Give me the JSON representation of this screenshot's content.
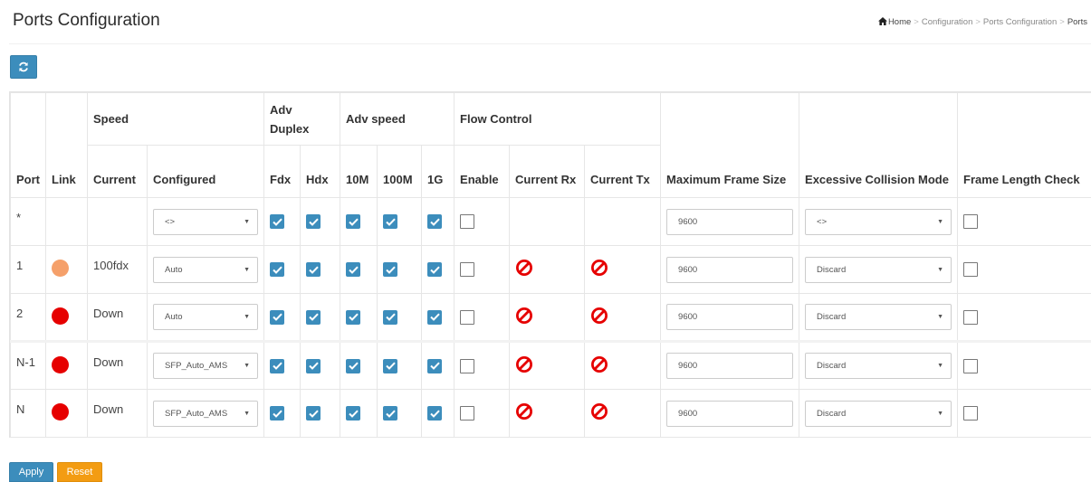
{
  "header": {
    "title": "Ports Configuration",
    "breadcrumb": [
      "Home",
      "Configuration",
      "Ports Configuration",
      "Ports"
    ]
  },
  "columns": {
    "port": "Port",
    "link": "Link",
    "speed": "Speed",
    "current": "Current",
    "configured": "Configured",
    "adv_duplex": "Adv Duplex",
    "fdx": "Fdx",
    "hdx": "Hdx",
    "adv_speed": "Adv speed",
    "s10m": "10M",
    "s100m": "100M",
    "s1g": "1G",
    "flow_control": "Flow Control",
    "enable": "Enable",
    "current_rx": "Current Rx",
    "current_tx": "Current Tx",
    "max_frame": "Maximum Frame Size",
    "excessive_collision": "Excessive Collision Mode",
    "frame_length_check": "Frame Length Check"
  },
  "rows": [
    {
      "port": "*",
      "link": "",
      "current": "",
      "configured": "<>",
      "max_frame": "9600",
      "collision": "<>"
    },
    {
      "port": "1",
      "link": "orange",
      "current": "100fdx",
      "configured": "Auto",
      "max_frame": "9600",
      "collision": "Discard"
    },
    {
      "port": "2",
      "link": "red",
      "current": "Down",
      "configured": "Auto",
      "max_frame": "9600",
      "collision": "Discard"
    },
    {
      "port": "N-1",
      "link": "red",
      "current": "Down",
      "configured": "SFP_Auto_AMS",
      "max_frame": "9600",
      "collision": "Discard"
    },
    {
      "port": "N",
      "link": "red",
      "current": "Down",
      "configured": "SFP_Auto_AMS",
      "max_frame": "9600",
      "collision": "Discard"
    }
  ],
  "colors": {
    "primary": "#3c8dbc",
    "warning": "#f39c12",
    "link_up": "#f5a06a",
    "link_down": "#e60000",
    "no_entry": "#e60000"
  },
  "buttons": {
    "refresh_icon": "refresh-icon",
    "apply": "Apply",
    "reset": "Reset"
  }
}
